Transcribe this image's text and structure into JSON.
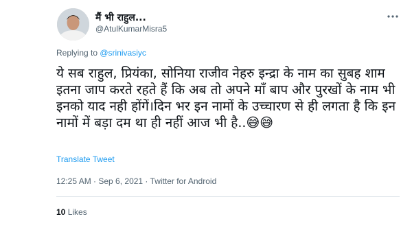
{
  "author": {
    "display_name": "मैं भी राहुल...",
    "handle": "@AtulKumarMisra5"
  },
  "reply": {
    "prefix": "Replying to ",
    "target": "@srinivasiyc"
  },
  "tweet": {
    "text": "ये सब राहुल, प्रियंका, सोनिया राजीव नेहरु इन्द्रा के नाम का सुबह शाम इतना जाप करते रहते हैं कि अब तो अपने माँ बाप और पुरखों के नाम भी इनको याद नही होंगें।दिन भर इन नामों के उच्चारण से ही लगता है कि इन नामों में बड़ा दम था ही नहीं आज भी है..😅😅",
    "translate_label": "Translate Tweet",
    "meta": "12:25 AM · Sep 6, 2021 · Twitter for Android"
  },
  "stats": {
    "likes_count": "10",
    "likes_label": "Likes"
  },
  "icons": {
    "more": "more-horizontal-icon",
    "avatar": "profile-avatar"
  },
  "colors": {
    "link": "#1d9bf0",
    "secondary_text": "#536471",
    "primary_text": "#0f1419"
  }
}
